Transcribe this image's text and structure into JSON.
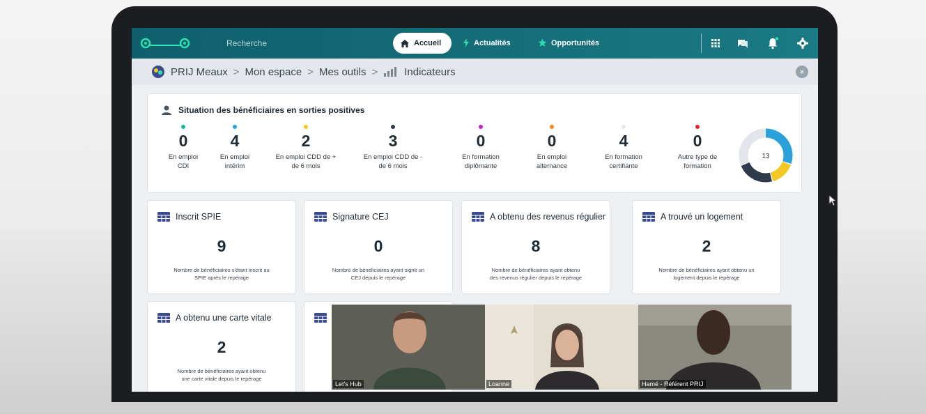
{
  "nav": {
    "search_label": "Recherche",
    "accueil": "Accueil",
    "actualites": "Actualités",
    "opportunites": "Opportunités"
  },
  "breadcrumb": {
    "root": "PRIJ Meaux",
    "espace": "Mon espace",
    "outils": "Mes outils",
    "current": "Indicateurs",
    "sep": ">"
  },
  "situation": {
    "title": "Situation des bénéficiaires en sorties positives",
    "total": "13",
    "stats": [
      {
        "value": "0",
        "label1": "En emploi",
        "label2": "CDI",
        "color": "#1fb5a5"
      },
      {
        "value": "4",
        "label1": "En emploi",
        "label2": "intérim",
        "color": "#2aa1d8"
      },
      {
        "value": "2",
        "label1": "En emploi CDD de +",
        "label2": "de 6 mois",
        "color": "#f2c824"
      },
      {
        "value": "3",
        "label1": "En emploi CDD de -",
        "label2": "de 6 mois",
        "color": "#2f3a4a"
      },
      {
        "value": "0",
        "label1": "En formation",
        "label2": "diplômante",
        "color": "#c824c8"
      },
      {
        "value": "0",
        "label1": "En emploi",
        "label2": "alternance",
        "color": "#f08a24"
      },
      {
        "value": "4",
        "label1": "En formation",
        "label2": "certifiante",
        "color": "#e6e9ec"
      },
      {
        "value": "0",
        "label1": "Autre type de",
        "label2": "formation",
        "color": "#e8242a"
      }
    ]
  },
  "kpis": [
    {
      "title": "Inscrit SPIE",
      "value": "9",
      "desc1": "Nombre de bénéficiaires s'étant inscrit au",
      "desc2": "SPIE après le repérage"
    },
    {
      "title": "Signature CEJ",
      "value": "0",
      "desc1": "Nombre de bénéficiaires ayant signé un",
      "desc2": "CEJ depuis le repérage"
    },
    {
      "title": "A obtenu des revenus régulier",
      "value": "8",
      "desc1": "Nombre de bénéficiaires ayant obtenu",
      "desc2": "des revenus régulier depuis le repérage"
    },
    {
      "title": "A trouvé un logement",
      "value": "2",
      "desc1": "Nombre de bénéficiaires ayant obtenu un",
      "desc2": "logement depuis le repérage"
    },
    {
      "title": "A obtenu une carte vitale",
      "value": "2",
      "desc1": "Nombre de bénéficiaires ayant obtenu",
      "desc2": "une carte vitale depuis le repérage"
    }
  ],
  "videos": [
    {
      "name": "Let's Hub"
    },
    {
      "name": "Loanne"
    },
    {
      "name": "Hamé - Référent PRIJ"
    }
  ],
  "colors": {
    "topbar": "#0e5f6b",
    "accent": "#1b7a84"
  }
}
